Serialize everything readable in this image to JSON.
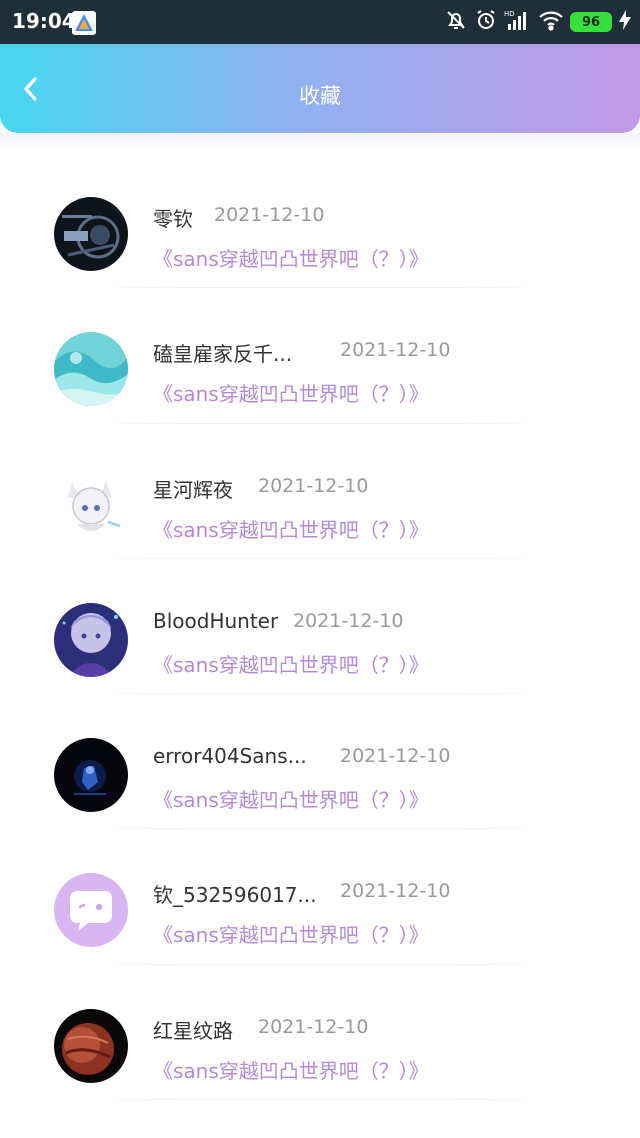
{
  "status_bar": {
    "time": "19:04",
    "battery": "96",
    "icons": [
      "app-icon",
      "mute-bell-icon",
      "alarm-icon",
      "signal-hd-icon",
      "wifi-icon",
      "battery-icon",
      "charging-icon"
    ]
  },
  "header": {
    "title": "收藏",
    "back_icon": "chevron-left-icon",
    "gradient": [
      "#47d7f1",
      "#c29ae8"
    ]
  },
  "colors": {
    "name": "#333333",
    "date": "#999999",
    "work_title": "#b48ad8"
  },
  "favorites": [
    {
      "name": "零钦",
      "date": "2021-12-10",
      "title": "《sans穿越凹凸世界吧（？）》",
      "avatar": "dark-robot-avatar"
    },
    {
      "name": "磕皇雇家反千...",
      "date": "2021-12-10",
      "title": "《sans穿越凹凸世界吧（？）》",
      "avatar": "ocean-wave-avatar"
    },
    {
      "name": "星河辉夜",
      "date": "2021-12-10",
      "title": "《sans穿越凹凸世界吧（？）》",
      "avatar": "white-fox-girl-avatar"
    },
    {
      "name": "BloodHunter",
      "date": "2021-12-10",
      "title": "《sans穿越凹凸世界吧（？）》",
      "avatar": "purple-anime-avatar"
    },
    {
      "name": "error404Sans...",
      "date": "2021-12-10",
      "title": "《sans穿越凹凸世界吧（？）》",
      "avatar": "dark-blue-figure-avatar"
    },
    {
      "name": "钦_532596017...",
      "date": "2021-12-10",
      "title": "《sans穿越凹凸世界吧（？）》",
      "avatar": "default-chat-bubble-avatar"
    },
    {
      "name": "红星纹路",
      "date": "2021-12-10",
      "title": "《sans穿越凹凸世界吧（？）》",
      "avatar": "red-planet-avatar"
    }
  ]
}
